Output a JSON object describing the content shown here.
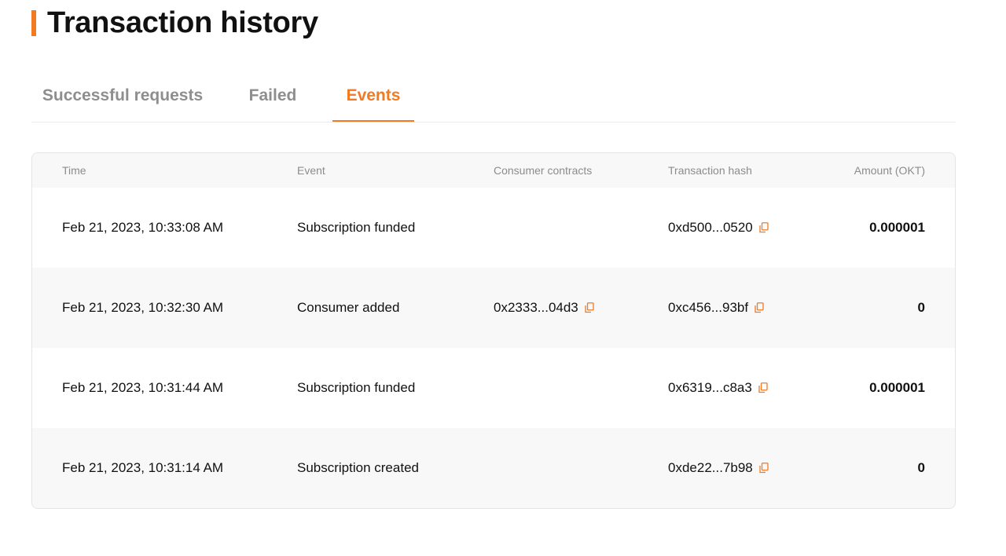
{
  "header": {
    "title": "Transaction history",
    "accent_color": "#f27a22"
  },
  "tabs": [
    {
      "label": "Successful requests",
      "active": false
    },
    {
      "label": "Failed",
      "active": false
    },
    {
      "label": "Events",
      "active": true
    }
  ],
  "table": {
    "columns": [
      "Time",
      "Event",
      "Consumer contracts",
      "Transaction hash",
      "Amount (OKT)"
    ],
    "rows": [
      {
        "time": "Feb 21, 2023, 10:33:08 AM",
        "event": "Subscription funded",
        "consumer": "",
        "hash": "0xd500...0520",
        "amount": "0.000001"
      },
      {
        "time": "Feb 21, 2023, 10:32:30 AM",
        "event": "Consumer added",
        "consumer": "0x2333...04d3",
        "hash": "0xc456...93bf",
        "amount": "0"
      },
      {
        "time": "Feb 21, 2023, 10:31:44 AM",
        "event": "Subscription funded",
        "consumer": "",
        "hash": "0x6319...c8a3",
        "amount": "0.000001"
      },
      {
        "time": "Feb 21, 2023, 10:31:14 AM",
        "event": "Subscription created",
        "consumer": "",
        "hash": "0xde22...7b98",
        "amount": "0"
      }
    ]
  },
  "icons": {
    "copy": "copy-icon"
  }
}
